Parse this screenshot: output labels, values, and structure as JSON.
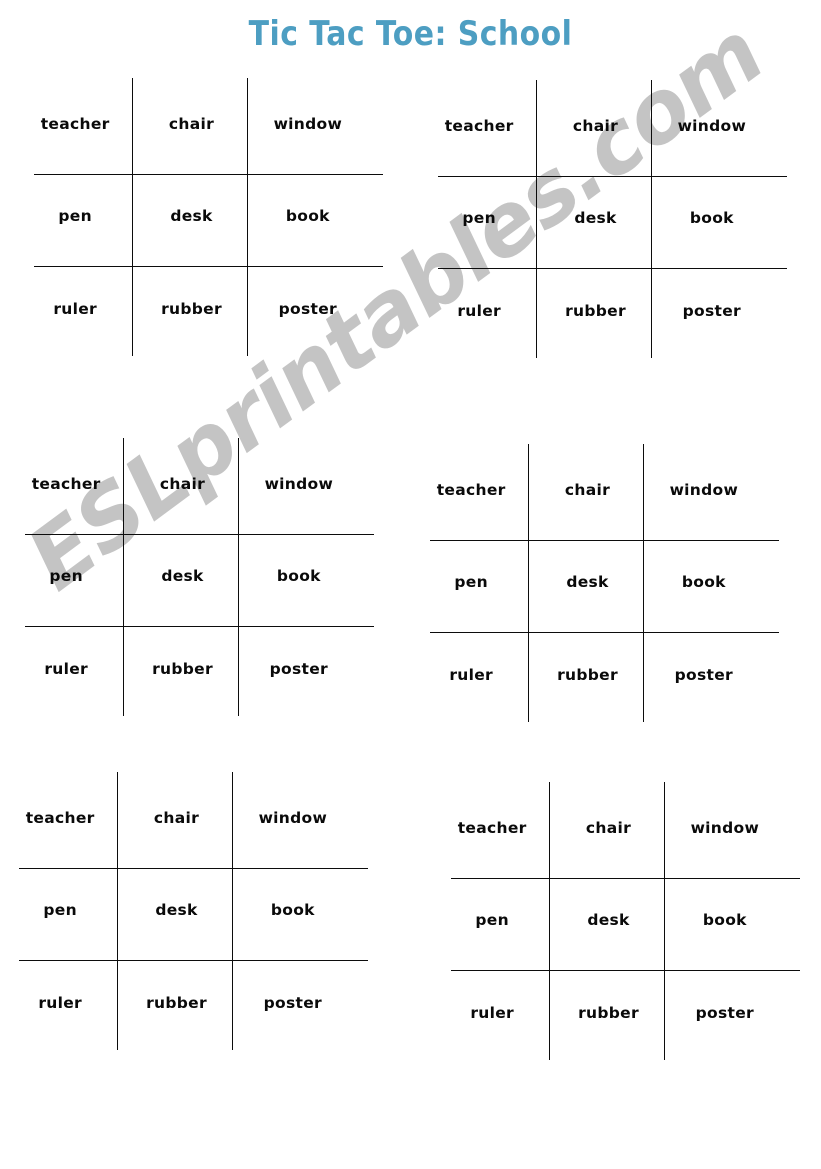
{
  "page": {
    "title": "Tic Tac Toe: School",
    "title_color": "#4d9ec2",
    "background_color": "#ffffff",
    "text_color": "#0a0a0a",
    "line_color": "#0c0c0c"
  },
  "watermark": {
    "text": "ESLprintables.com",
    "color": "#c4c4c4"
  },
  "board": {
    "rows": [
      [
        "teacher",
        "chair",
        "window"
      ],
      [
        "pen",
        "desk",
        "book"
      ],
      [
        "ruler",
        "rubber",
        "poster"
      ]
    ]
  },
  "grids": [
    {
      "id": "grid-1",
      "cells": [
        "teacher",
        "chair",
        "window",
        "pen",
        "desk",
        "book",
        "ruler",
        "rubber",
        "poster"
      ]
    },
    {
      "id": "grid-2",
      "cells": [
        "teacher",
        "chair",
        "window",
        "pen",
        "desk",
        "book",
        "ruler",
        "rubber",
        "poster"
      ]
    },
    {
      "id": "grid-3",
      "cells": [
        "teacher",
        "chair",
        "window",
        "pen",
        "desk",
        "book",
        "ruler",
        "rubber",
        "poster"
      ]
    },
    {
      "id": "grid-4",
      "cells": [
        "teacher",
        "chair",
        "window",
        "pen",
        "desk",
        "book",
        "ruler",
        "rubber",
        "poster"
      ]
    },
    {
      "id": "grid-5",
      "cells": [
        "teacher",
        "chair",
        "window",
        "pen",
        "desk",
        "book",
        "ruler",
        "rubber",
        "poster"
      ]
    },
    {
      "id": "grid-6",
      "cells": [
        "teacher",
        "chair",
        "window",
        "pen",
        "desk",
        "book",
        "ruler",
        "rubber",
        "poster"
      ]
    }
  ]
}
